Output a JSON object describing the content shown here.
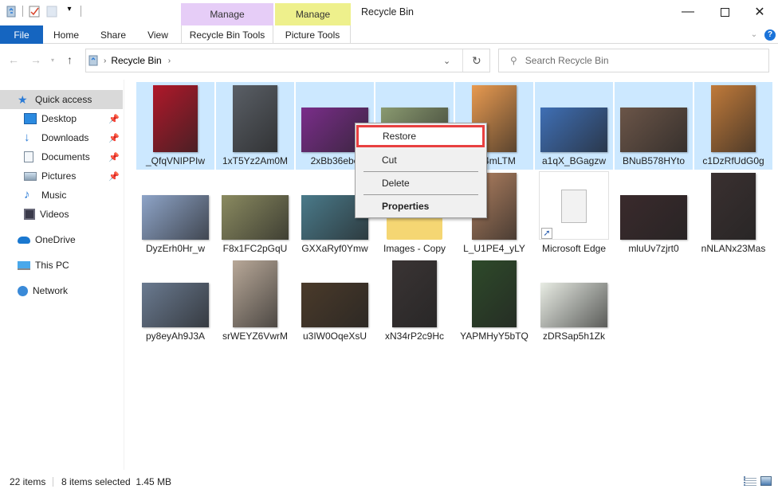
{
  "window": {
    "title": "Recycle Bin",
    "minimize_icon": "minimize-icon",
    "maximize_icon": "maximize-icon",
    "close_icon": "close-icon"
  },
  "quick_access_toolbar": {
    "icons": [
      "recycle-bin-icon",
      "properties-icon",
      "new-folder-icon",
      "customize-dropdown-icon"
    ]
  },
  "contextual_tabs": [
    {
      "group": "Manage",
      "label": "Recycle Bin Tools",
      "color": "#e6cdf7"
    },
    {
      "group": "Manage",
      "label": "Picture Tools",
      "color": "#eef08c"
    }
  ],
  "ribbon": {
    "tabs": [
      "File",
      "Home",
      "Share",
      "View"
    ],
    "file_color": "#1565c0"
  },
  "address_bar": {
    "path": [
      "Recycle Bin"
    ],
    "search_placeholder": "Search Recycle Bin"
  },
  "sidebar": {
    "quick_access": "Quick access",
    "items": [
      {
        "label": "Desktop",
        "icon": "desktop-icon",
        "pinned": true
      },
      {
        "label": "Downloads",
        "icon": "downloads-icon",
        "pinned": true
      },
      {
        "label": "Documents",
        "icon": "documents-icon",
        "pinned": true
      },
      {
        "label": "Pictures",
        "icon": "pictures-icon",
        "pinned": true
      },
      {
        "label": "Music",
        "icon": "music-icon",
        "pinned": false
      },
      {
        "label": "Videos",
        "icon": "videos-icon",
        "pinned": false
      }
    ],
    "locations": [
      {
        "label": "OneDrive",
        "icon": "onedrive-icon"
      },
      {
        "label": "This PC",
        "icon": "this-pc-icon"
      },
      {
        "label": "Network",
        "icon": "network-icon"
      }
    ]
  },
  "files": [
    {
      "name": "_QfqVNIPPIw",
      "selected": true,
      "color": "#b0182a",
      "shape": "portrait"
    },
    {
      "name": "1xT5Yz2Am0M",
      "selected": true,
      "color": "#5a5f66",
      "shape": "portrait"
    },
    {
      "name": "2xBb36ebe",
      "selected": true,
      "color": "#7a2d8a",
      "shape": "landscape"
    },
    {
      "name": "",
      "selected": true,
      "color": "#8a9a70",
      "shape": "landscape"
    },
    {
      "name": "1F4mLTM",
      "selected": true,
      "color": "#e89a50",
      "shape": "portrait"
    },
    {
      "name": "a1qX_BGagzw",
      "selected": true,
      "color": "#3f6fb5",
      "shape": "landscape"
    },
    {
      "name": "BNuB578HYto",
      "selected": true,
      "color": "#6b5548",
      "shape": "landscape"
    },
    {
      "name": "c1DzRfUdG0g",
      "selected": true,
      "color": "#c07a3a",
      "shape": "portrait"
    },
    {
      "name": "DyzErh0Hr_w",
      "selected": false,
      "color": "#8ea4c8",
      "shape": "landscape"
    },
    {
      "name": "F8x1FC2pGqU",
      "selected": false,
      "color": "#8a8a60",
      "shape": "landscape"
    },
    {
      "name": "GXXaRyf0Ymw",
      "selected": false,
      "color": "#4a7a8a",
      "shape": "landscape"
    },
    {
      "name": "Images - Copy",
      "selected": false,
      "color": "#f5d673",
      "shape": "folder"
    },
    {
      "name": "L_U1PE4_yLY",
      "selected": false,
      "color": "#b08060",
      "shape": "portrait"
    },
    {
      "name": "Microsoft Edge",
      "selected": false,
      "color": "#f2f2f2",
      "shape": "shortcut"
    },
    {
      "name": "mluUv7zjrt0",
      "selected": false,
      "color": "#3a2a2c",
      "shape": "landscape"
    },
    {
      "name": "nNLANx23Mas",
      "selected": false,
      "color": "#3a3030",
      "shape": "portrait"
    },
    {
      "name": "py8eyAh9J3A",
      "selected": false,
      "color": "#6a7a90",
      "shape": "landscape"
    },
    {
      "name": "srWEYZ6VwrM",
      "selected": false,
      "color": "#b8a898",
      "shape": "portrait"
    },
    {
      "name": "u3IW0OqeXsU",
      "selected": false,
      "color": "#4a3a2a",
      "shape": "landscape"
    },
    {
      "name": "xN34rP2c9Hc",
      "selected": false,
      "color": "#3a3434",
      "shape": "portrait"
    },
    {
      "name": "YAPMHyY5bTQ",
      "selected": false,
      "color": "#2e4a2a",
      "shape": "portrait"
    },
    {
      "name": "zDRSap5h1Zk",
      "selected": false,
      "color": "#e8ece4",
      "shape": "landscape"
    }
  ],
  "context_menu": {
    "items": [
      {
        "label": "Restore",
        "highlighted": true,
        "bold": false
      },
      {
        "label": "Cut",
        "highlighted": false,
        "bold": false
      },
      {
        "label": "Delete",
        "highlighted": false,
        "bold": false
      },
      {
        "label": "Properties",
        "highlighted": false,
        "bold": true
      }
    ],
    "highlight_color": "#e84040"
  },
  "status_bar": {
    "item_count": "22 items",
    "selection": "8 items selected  1.45 MB",
    "view_icons": [
      "details-view-icon",
      "large-icons-view-icon"
    ]
  }
}
